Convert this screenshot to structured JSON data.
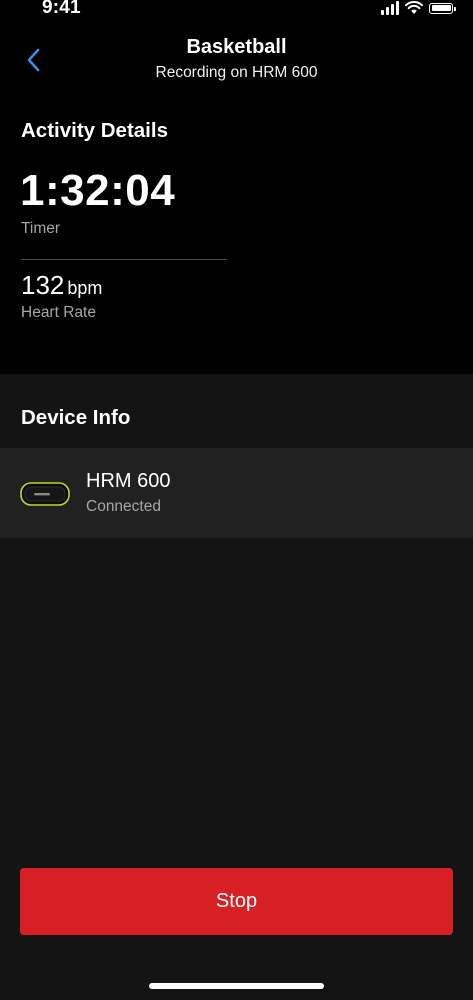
{
  "status_bar": {
    "time": "9:41"
  },
  "header": {
    "title": "Basketball",
    "subtitle": "Recording on HRM 600",
    "back_icon": "chevron-left-icon"
  },
  "activity": {
    "section_title": "Activity Details",
    "timer_value": "1:32:04",
    "timer_label": "Timer",
    "heart_rate_value": "132",
    "heart_rate_unit": "bpm",
    "heart_rate_label": "Heart Rate"
  },
  "device": {
    "section_title": "Device Info",
    "name": "HRM 600",
    "status": "Connected",
    "icon": "heart-rate-monitor-icon"
  },
  "actions": {
    "stop_label": "Stop"
  },
  "colors": {
    "background": "#000000",
    "panel": "#141414",
    "row": "#212121",
    "accent_blue": "#3a8ee6",
    "stop_red": "#d62023",
    "device_accent": "#c5d625"
  }
}
